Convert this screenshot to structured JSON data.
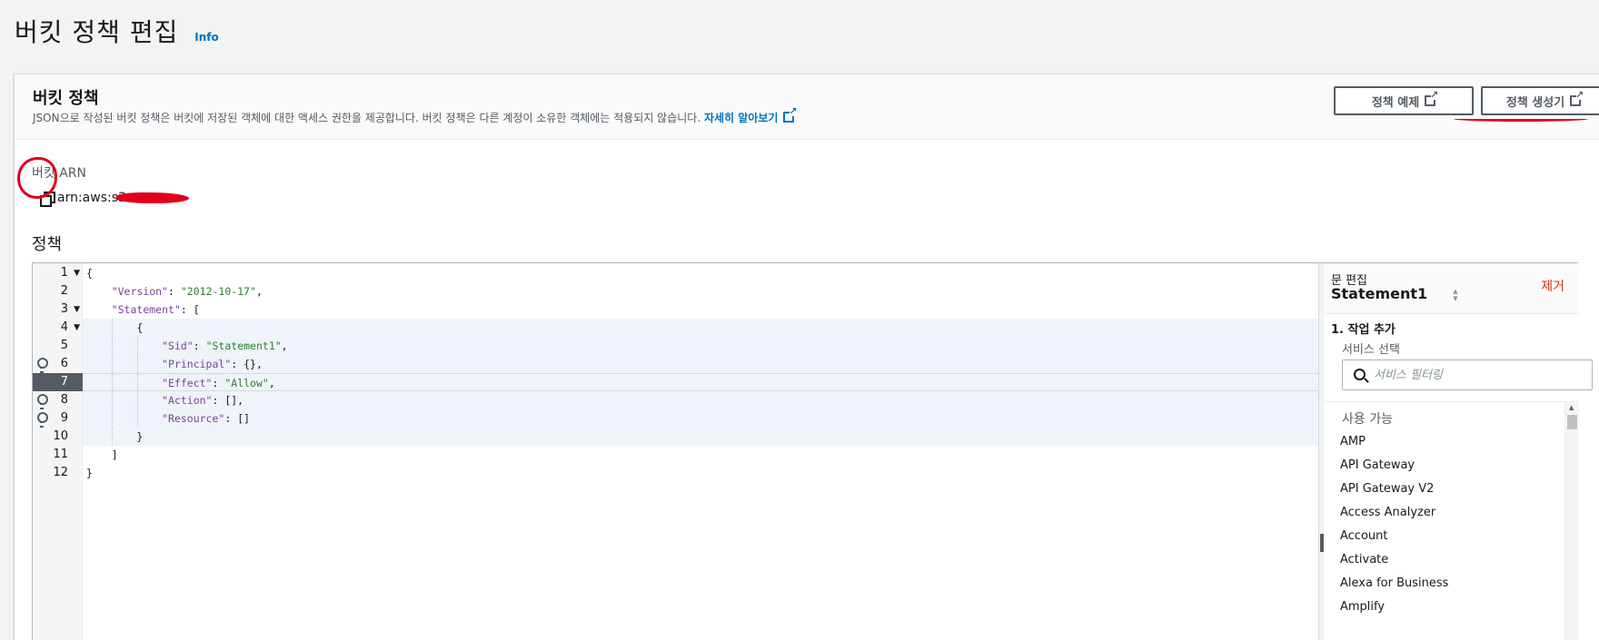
{
  "page": {
    "title": "버킷 정책 편집",
    "info": "Info"
  },
  "panel": {
    "title": "버킷 정책",
    "description": "JSON으로 작성된 버킷 정책은 버킷에 저장된 객체에 대한 액세스 권한을 제공합니다. 버킷 정책은 다른 계정이 소유한 객체에는 적용되지 않습니다.",
    "learn_more": "자세히 알아보기",
    "examples_button": "정책 예제",
    "generator_button": "정책 생성기"
  },
  "arn": {
    "label": "버킷 ARN",
    "value": "arn:aws:s3:::"
  },
  "policy": {
    "label": "정책"
  },
  "editor": {
    "active_line": 7,
    "lines": [
      "{",
      "    \"Version\": \"2012-10-17\",",
      "    \"Statement\": [",
      "        {",
      "            \"Sid\": \"Statement1\",",
      "            \"Principal\": {},",
      "            \"Effect\": \"Allow\",",
      "            \"Action\": [],",
      "            \"Resource\": []",
      "        }",
      "    ]",
      "}"
    ]
  },
  "statement_editor": {
    "header": "문 편집",
    "statement_name": "Statement1",
    "remove": "제거",
    "step": "1. 작업 추가",
    "service_label": "서비스 선택",
    "filter_placeholder": "서비스 필터링",
    "available_label": "사용 가능",
    "services": [
      "AMP",
      "API Gateway",
      "API Gateway V2",
      "Access Analyzer",
      "Account",
      "Activate",
      "Alexa for Business",
      "Amplify"
    ]
  },
  "colors": {
    "link": "#0073bb",
    "annotation": "#e0001b",
    "remove": "#d13212"
  }
}
